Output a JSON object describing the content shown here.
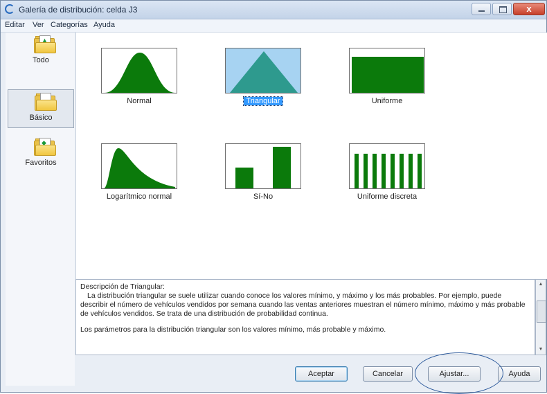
{
  "window": {
    "title": "Galería de distribución: celda J3",
    "minimize_label": "",
    "maximize_label": "",
    "close_label": "x"
  },
  "menu": {
    "items": [
      "Editar",
      "Ver",
      "Categorías",
      "Ayuda"
    ]
  },
  "sidebar": {
    "items": [
      {
        "label": "Todo",
        "icon": "folder-all-icon"
      },
      {
        "label": "Básico",
        "icon": "folder-basic-icon",
        "selected": true
      },
      {
        "label": "Favoritos",
        "icon": "folder-favorites-icon"
      }
    ]
  },
  "gallery": {
    "items": [
      {
        "label": "Normal",
        "shape": "normal"
      },
      {
        "label": "Triangular",
        "shape": "triangular",
        "selected": true
      },
      {
        "label": "Uniforme",
        "shape": "uniform"
      },
      {
        "label": "Logarítmico normal",
        "shape": "lognormal"
      },
      {
        "label": "Sí-No",
        "shape": "yesno"
      },
      {
        "label": "Uniforme discreta",
        "shape": "discrete-uniform"
      }
    ],
    "colors": {
      "fill": "#0b7a0b",
      "selected_bg": "#a7d3f2",
      "triangle": "#2e9a8e"
    }
  },
  "description": {
    "heading": "Descripción de Triangular:",
    "para1": "La distribución triangular se suele utilizar cuando conoce los valores mínimo, y máximo y los más probables. Por ejemplo, puede describir el número de vehículos vendidos por semana cuando las ventas anteriores muestran el número mínimo, máximo y más probable de vehículos vendidos. Se trata de una distribución de probabilidad continua.",
    "para2": "Los parámetros para la distribución triangular son los valores mínimo, más probable y máximo."
  },
  "buttons": {
    "accept": "Aceptar",
    "cancel": "Cancelar",
    "adjust": "Ajustar...",
    "help": "Ayuda"
  }
}
